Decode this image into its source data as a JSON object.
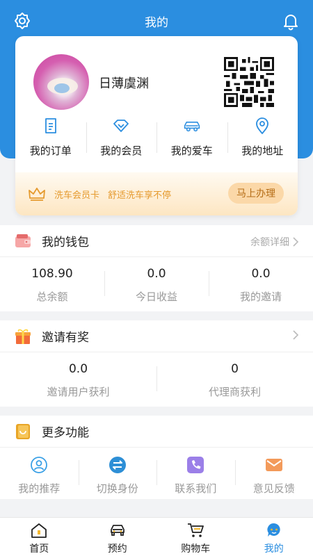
{
  "header": {
    "title": "我的"
  },
  "profile": {
    "username": "日薄虞渊"
  },
  "quick_links": [
    {
      "label": "我的订单",
      "icon": "order-icon"
    },
    {
      "label": "我的会员",
      "icon": "diamond-icon"
    },
    {
      "label": "我的爱车",
      "icon": "car-icon"
    },
    {
      "label": "我的地址",
      "icon": "location-icon"
    }
  ],
  "member_banner": {
    "card_name": "洗车会员卡",
    "slogan": "舒适洗车享不停",
    "button": "马上办理"
  },
  "wallet": {
    "title": "我的钱包",
    "detail_link": "余额详细",
    "stats": [
      {
        "value": "108.90",
        "label": "总余额"
      },
      {
        "value": "0.0",
        "label": "今日收益"
      },
      {
        "value": "0.0",
        "label": "我的邀请"
      }
    ]
  },
  "invite": {
    "title": "邀请有奖",
    "stats": [
      {
        "value": "0.0",
        "label": "邀请用户获利"
      },
      {
        "value": "0",
        "label": "代理商获利"
      }
    ]
  },
  "more": {
    "title": "更多功能",
    "tools": [
      {
        "label": "我的推荐",
        "icon": "user-recommend-icon"
      },
      {
        "label": "切换身份",
        "icon": "switch-identity-icon"
      },
      {
        "label": "联系我们",
        "icon": "phone-icon"
      },
      {
        "label": "意见反馈",
        "icon": "feedback-mail-icon"
      }
    ]
  },
  "tabbar": [
    {
      "label": "首页",
      "icon": "home-icon",
      "active": false
    },
    {
      "label": "预约",
      "icon": "car-front-icon",
      "active": false
    },
    {
      "label": "购物车",
      "icon": "cart-icon",
      "active": false
    },
    {
      "label": "我的",
      "icon": "profile-chat-icon",
      "active": true
    }
  ],
  "colors": {
    "primary": "#2b8ee0",
    "member_orange": "#e59a2e",
    "muted": "#999999",
    "background": "#f2f3f5"
  }
}
